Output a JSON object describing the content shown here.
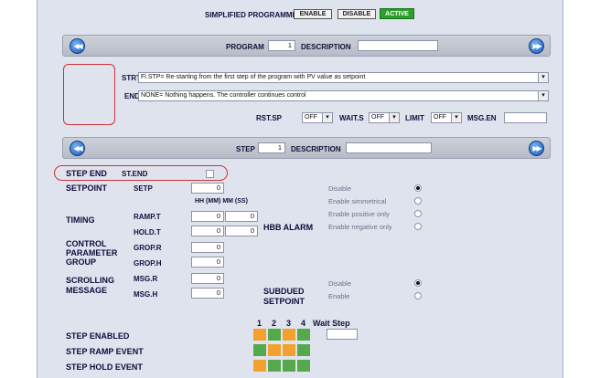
{
  "header": {
    "title": "SIMPLIFIED PROGRAMMER",
    "enable_label": "ENABLE",
    "disable_label": "DISABLE",
    "active_label": "ACTIVE"
  },
  "program_bar": {
    "label": "PROGRAM",
    "number": "1",
    "description_label": "DESCRIPTION",
    "description_value": "",
    "prev_icon": "rewind-icon",
    "next_icon": "fast-forward-icon"
  },
  "start": {
    "label": "STRT",
    "value": "Fl.STP= Re-starting from the first step of the program with PV value as setpoint"
  },
  "end": {
    "label": "END",
    "value": "NONE= Nothing happens. The controller continues control"
  },
  "program_options": {
    "rst_sp_label": "RST.SP",
    "rst_sp_value": "OFF",
    "wait_s_label": "WAIT.S",
    "wait_s_value": "OFF",
    "limit_label": "LIMIT",
    "limit_value": "OFF",
    "msg_en_label": "MSG.EN",
    "msg_en_value": ""
  },
  "step_bar": {
    "label": "STEP",
    "number": "1",
    "description_label": "DESCRIPTION",
    "description_value": ""
  },
  "step_end": {
    "label": "STEP END",
    "code": "ST.END",
    "checked": false
  },
  "setpoint": {
    "label": "SETPOINT",
    "code": "SETP",
    "value": "0"
  },
  "time_header": "HH (MM) MM (SS)",
  "timing": {
    "label": "TIMING",
    "ramp_code": "RAMP.T",
    "ramp_a": "0",
    "ramp_b": "0",
    "hold_code": "HOLD.T",
    "hold_a": "0",
    "hold_b": "0"
  },
  "control_group": {
    "label_1": "CONTROL",
    "label_2": "PARAMETER",
    "label_3": "GROUP",
    "r_code": "GROP.R",
    "r_value": "0",
    "h_code": "GROP.H",
    "h_value": "0"
  },
  "scrolling": {
    "label_1": "SCROLLING",
    "label_2": "MESSAGE",
    "r_code": "MSG.R",
    "r_value": "0",
    "h_code": "MSG.H",
    "h_value": "0"
  },
  "hbb_alarm": {
    "label": "HBB ALARM",
    "options": [
      "Disable",
      "Enable simmetrical",
      "Enable positive only",
      "Enable negative only"
    ],
    "selected": 0
  },
  "subdued": {
    "label_1": "SUBDUED",
    "label_2": "SETPOINT",
    "options": [
      "Disable",
      "Enable"
    ],
    "selected": 0
  },
  "events": {
    "columns": [
      "1",
      "2",
      "3",
      "4"
    ],
    "wait_step_label": "Wait Step",
    "wait_step_value": "",
    "rows": [
      {
        "label": "STEP ENABLED",
        "cells": [
          "orange",
          "green",
          "orange",
          "green"
        ]
      },
      {
        "label": "STEP RAMP EVENT",
        "cells": [
          "green",
          "orange",
          "orange",
          "green"
        ]
      },
      {
        "label": "STEP HOLD EVENT",
        "cells": [
          "orange",
          "green",
          "green",
          "green"
        ]
      }
    ]
  },
  "colors": {
    "orange": "#f2a12e",
    "green": "#55a84b",
    "accent": "#2aa12a",
    "highlight": "#d0303a"
  }
}
